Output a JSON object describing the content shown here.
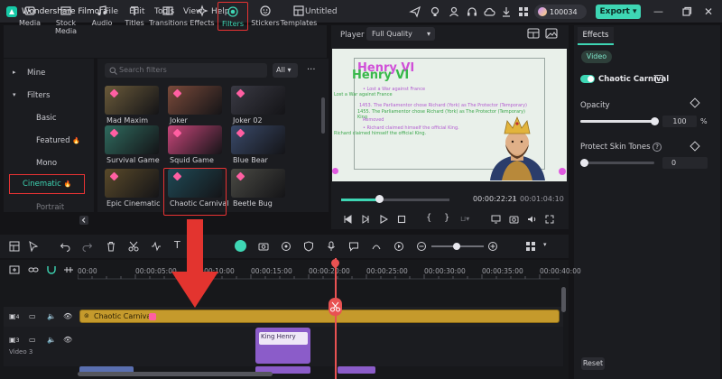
{
  "app": {
    "name": "Wondershare Filmora",
    "document_title": "Untitled"
  },
  "menu": [
    "File",
    "Edit",
    "Tools",
    "View",
    "Help"
  ],
  "topbar": {
    "credits": "100034",
    "export_label": "Export"
  },
  "tool_tabs": [
    {
      "label": "Media",
      "icon": "media-icon"
    },
    {
      "label": "Stock Media",
      "icon": "stock-media-icon"
    },
    {
      "label": "Audio",
      "icon": "music-note-icon"
    },
    {
      "label": "Titles",
      "icon": "titles-icon"
    },
    {
      "label": "Transitions",
      "icon": "transitions-icon"
    },
    {
      "label": "Effects",
      "icon": "effects-icon"
    },
    {
      "label": "Filters",
      "icon": "filters-icon",
      "active": true
    },
    {
      "label": "Stickers",
      "icon": "stickers-icon"
    },
    {
      "label": "Templates",
      "icon": "templates-icon"
    }
  ],
  "categories": {
    "mine": "Mine",
    "filters": "Filters",
    "items": [
      "Basic",
      "Featured",
      "Mono",
      "Cinematic",
      "Portrait"
    ],
    "selected": "Cinematic"
  },
  "search": {
    "placeholder": "Search filters",
    "filter_value": "All"
  },
  "filter_grid": [
    {
      "label": "Mad Maxim",
      "c": "#6a5a3a"
    },
    {
      "label": "Joker",
      "c": "#7a4a3a"
    },
    {
      "label": "Joker 02",
      "c": "#3a3a44"
    },
    {
      "label": "Survival Game",
      "c": "#2f6a5e"
    },
    {
      "label": "Squid Game",
      "c": "#c8467a"
    },
    {
      "label": "Blue Bear",
      "c": "#3a4a6a"
    },
    {
      "label": "Epic Cinematic",
      "c": "#5a4a2a"
    },
    {
      "label": "Chaotic Carnival",
      "c": "#1f4a56"
    },
    {
      "label": "Beetle Bug",
      "c": "#4a4a44"
    }
  ],
  "player": {
    "label": "Player",
    "quality": "Full Quality",
    "current_time": "00:00:22:21",
    "total_time": "00:01:04:10",
    "progress": 0.35,
    "canvas": {
      "title_pink": "Henry VI",
      "title_green": "Henry VI",
      "lines": [
        "• Lost a War against France",
        "Lost a War against France",
        "1453. The Parliamentor chose Richard (York) as The Protector (Temporary)",
        "1455. The Parliamentor chose Richard (York) as The Protector (Temporary)",
        "King",
        "Removed",
        "• Richard claimed himself the official King.",
        "Richard claimed himself the official King."
      ]
    }
  },
  "props": {
    "tab": "Effects",
    "sub_tab": "Video",
    "effect_name": "Chaotic Carnival",
    "opacity_label": "Opacity",
    "opacity_value": "100",
    "opacity_unit": "%",
    "opacity_level": 1.0,
    "skin_label": "Protect Skin Tones",
    "skin_value": "0",
    "skin_level": 0,
    "reset_label": "Reset"
  },
  "timeline": {
    "ticks": [
      "00:00",
      "00:00:05:00",
      "00:00:10:00",
      "00:00:15:00",
      "00:00:20:00",
      "00:00:25:00",
      "00:00:30:00",
      "00:00:35:00",
      "00:00:40:00"
    ],
    "track_effect_num": "4",
    "track_video_num": "3",
    "track_video_label": "Video 3",
    "effect_clip_label": "Chaotic Carnival",
    "video_clip_label": "King Henry"
  },
  "colors": {
    "accent": "#3ed6b4",
    "highlight": "#e83333",
    "clip_effect": "#c59a2c",
    "clip_video": "#8b5cc9"
  }
}
